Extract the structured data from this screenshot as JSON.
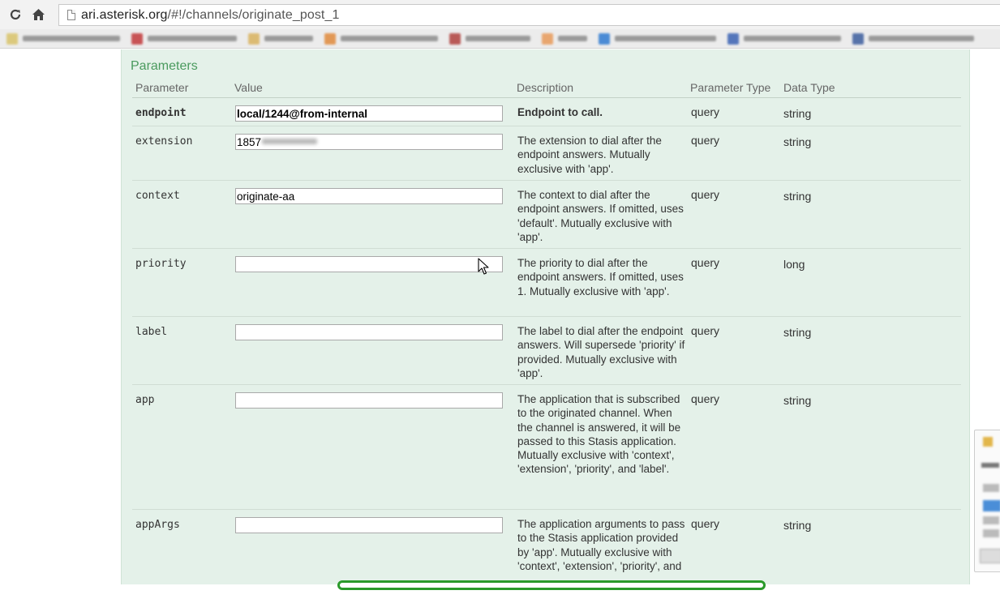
{
  "browser": {
    "reload_icon": "reload-icon",
    "home_icon": "home-icon",
    "url_host": "ari.asterisk.org",
    "url_path": "/#!/channels/originate_post_1"
  },
  "bookmark_colors": [
    "#d9c46a",
    "#c2393b",
    "#d9b35f",
    "#e08a3c",
    "#b0413e",
    "#e89a5a",
    "#2f7bd1",
    "#3a62b3",
    "#3d5e9e"
  ],
  "section": {
    "title": "Parameters",
    "headers": {
      "parameter": "Parameter",
      "value": "Value",
      "description": "Description",
      "parameter_type": "Parameter Type",
      "data_type": "Data Type"
    }
  },
  "params": [
    {
      "name": "endpoint",
      "value": "local/1244@from-internal",
      "description": "Endpoint to call.",
      "param_type": "query",
      "data_type": "string"
    },
    {
      "name": "extension",
      "value": "1857",
      "description": "The extension to dial after the endpoint answers. Mutually exclusive with 'app'.",
      "param_type": "query",
      "data_type": "string"
    },
    {
      "name": "context",
      "value": "originate-aa",
      "description": "The context to dial after the endpoint answers. If omitted, uses 'default'. Mutually exclusive with 'app'.",
      "param_type": "query",
      "data_type": "string"
    },
    {
      "name": "priority",
      "value": "",
      "description": "The priority to dial after the endpoint answers. If omitted, uses 1. Mutually exclusive with 'app'.",
      "param_type": "query",
      "data_type": "long"
    },
    {
      "name": "label",
      "value": "",
      "description": "The label to dial after the endpoint answers. Will supersede 'priority' if provided. Mutually exclusive with 'app'.",
      "param_type": "query",
      "data_type": "string"
    },
    {
      "name": "app",
      "value": "",
      "description": "The application that is subscribed to the originated channel. When the channel is answered, it will be passed to this Stasis application. Mutually exclusive with 'context', 'extension', 'priority', and 'label'.",
      "param_type": "query",
      "data_type": "string"
    },
    {
      "name": "appArgs",
      "value": "",
      "description": "The application arguments to pass to the Stasis application provided by 'app'. Mutually exclusive with 'context', 'extension', 'priority', and",
      "param_type": "query",
      "data_type": "string"
    }
  ]
}
